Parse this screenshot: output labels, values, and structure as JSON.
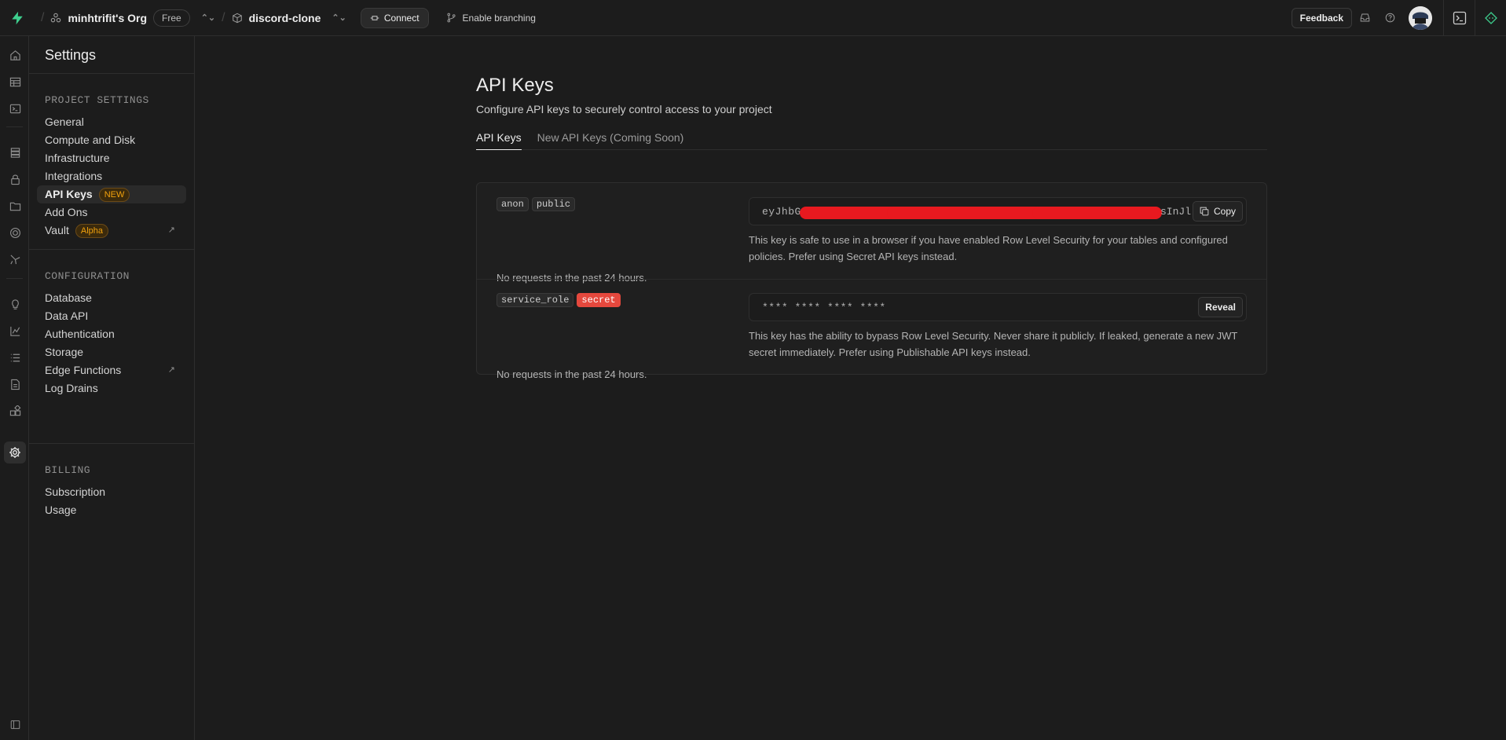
{
  "topbar": {
    "org_name": "minhtrifit's Org",
    "plan": "Free",
    "project_name": "discord-clone",
    "connect_label": "Connect",
    "branching_label": "Enable branching",
    "feedback_label": "Feedback"
  },
  "sidebar": {
    "title": "Settings",
    "project_settings": {
      "heading": "PROJECT SETTINGS",
      "items": [
        {
          "label": "General"
        },
        {
          "label": "Compute and Disk"
        },
        {
          "label": "Infrastructure"
        },
        {
          "label": "Integrations"
        },
        {
          "label": "API Keys",
          "badge": "NEW"
        },
        {
          "label": "Add Ons"
        },
        {
          "label": "Vault",
          "badge": "Alpha"
        }
      ]
    },
    "configuration": {
      "heading": "CONFIGURATION",
      "items": [
        {
          "label": "Database"
        },
        {
          "label": "Data API"
        },
        {
          "label": "Authentication"
        },
        {
          "label": "Storage"
        },
        {
          "label": "Edge Functions"
        },
        {
          "label": "Log Drains"
        }
      ]
    },
    "billing": {
      "heading": "BILLING",
      "items": [
        {
          "label": "Subscription"
        },
        {
          "label": "Usage"
        }
      ]
    }
  },
  "main": {
    "title": "API Keys",
    "subtitle": "Configure API keys to securely control access to your project",
    "tabs": [
      {
        "label": "API Keys",
        "active": true
      },
      {
        "label": "New API Keys (Coming Soon)",
        "active": false
      }
    ],
    "keys": [
      {
        "tags": [
          "anon",
          "public"
        ],
        "key_prefix": "eyJhbG",
        "key_suffix": "sInJl",
        "button": "Copy",
        "description": "This key is safe to use in a browser if you have enabled Row Level Security for your tables and configured policies. Prefer using Secret API keys instead.",
        "requests": "No requests in the past 24 hours."
      },
      {
        "tags": [
          "service_role",
          "secret"
        ],
        "key_masked": "**** **** **** ****",
        "button": "Reveal",
        "description": "This key has the ability to bypass Row Level Security. Never share it publicly. If leaked, generate a new JWT secret immediately. Prefer using Publishable API keys instead.",
        "requests": "No requests in the past 24 hours."
      }
    ]
  },
  "colors": {
    "accent": "#3ecf8e",
    "badge": "#f1a10d",
    "secret": "#e5483d"
  }
}
